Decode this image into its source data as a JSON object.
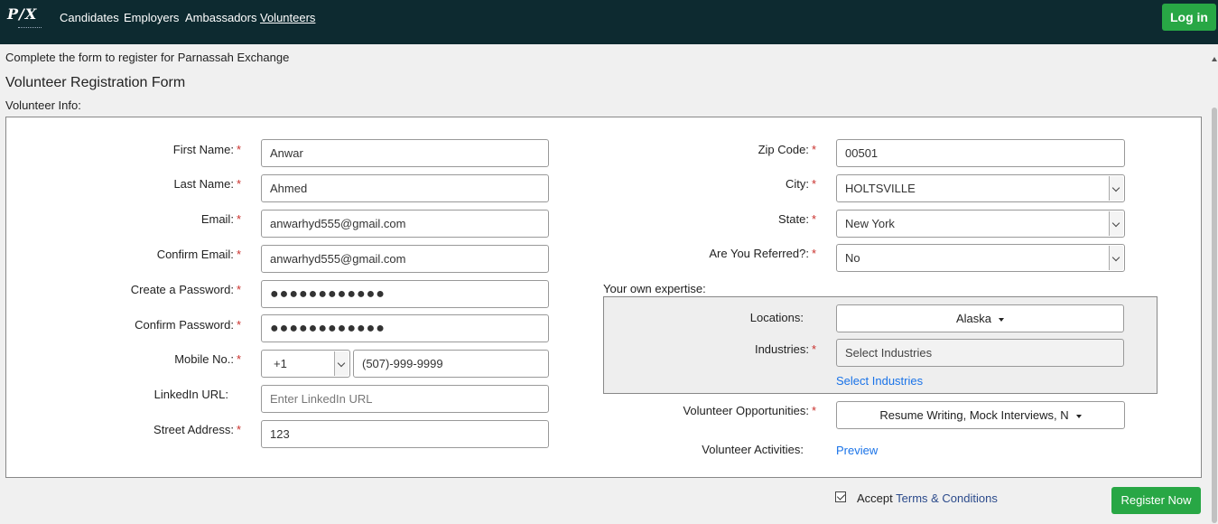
{
  "nav": {
    "logo_text": "P/X",
    "links": [
      "Candidates",
      "Employers",
      "Ambassadors",
      "Volunteers"
    ],
    "login_label": "Log in"
  },
  "intro_text": "Complete the form to register for Parnassah Exchange",
  "form_title": "Volunteer Registration Form",
  "section_label": "Volunteer Info:",
  "left": {
    "first_name_label": "First Name:",
    "first_name_value": "Anwar",
    "last_name_label": "Last Name:",
    "last_name_value": "Ahmed",
    "email_label": "Email:",
    "email_value": "anwarhyd555@gmail.com",
    "confirm_email_label": "Confirm Email:",
    "confirm_email_value": "anwarhyd555@gmail.com",
    "password_label": "Create a Password:",
    "password_value": "●●●●●●●●●●●●",
    "confirm_password_label": "Confirm Password:",
    "confirm_password_value": "●●●●●●●●●●●●",
    "mobile_label": "Mobile No.:",
    "country_code": "+1",
    "mobile_value": "(507)-999-9999",
    "linkedin_label": "LinkedIn URL:",
    "linkedin_placeholder": "Enter LinkedIn URL",
    "street_label": "Street Address:",
    "street_value": "123",
    "required_mark": "*"
  },
  "right": {
    "zip_label": "Zip Code:",
    "zip_value": "00501",
    "city_label": "City:",
    "city_value": "HOLTSVILLE",
    "state_label": "State:",
    "state_value": "New York",
    "referred_label": "Are You Referred?:",
    "referred_value": "No",
    "expertise_label": "Your own expertise:",
    "locations_label": "Locations:",
    "locations_value": "Alaska",
    "industries_label": "Industries:",
    "industries_placeholder": "Select Industries",
    "industries_link": "Select Industries",
    "opportunities_label": "Volunteer Opportunities:",
    "opportunities_value": "Resume Writing, Mock Interviews, N",
    "activities_label": "Volunteer Activities:",
    "activities_link": "Preview"
  },
  "footer": {
    "accept_label": "Accept",
    "terms_label": "Terms & Conditions",
    "register_label": "Register Now"
  },
  "colors": {
    "navbar_bg": "#0d2a30",
    "button_green": "#28a745",
    "link_blue": "#1a73e8",
    "required_red": "#c9302c"
  }
}
